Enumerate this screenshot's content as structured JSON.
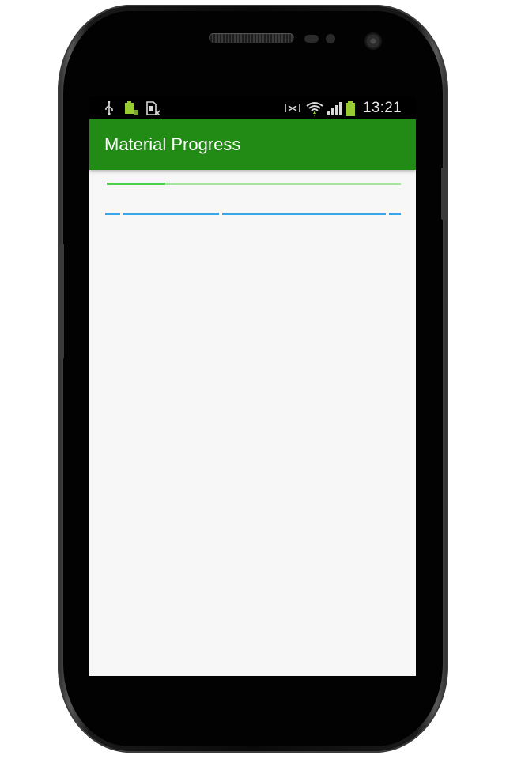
{
  "app": {
    "title": "Material Progress"
  },
  "status_bar": {
    "time": "13:21",
    "left_icons": [
      "usb-icon",
      "battery-full-icon",
      "sim-card-icon"
    ],
    "right_icons": [
      "no-signal-icon",
      "wifi-icon",
      "signal-icon",
      "battery-icon"
    ]
  },
  "progress": {
    "determinate_value": 0.2,
    "indeterminate": true
  },
  "colors": {
    "action_bar": "#218b15",
    "progress_track": "#a6e79d",
    "progress_fill": "#4cd24a",
    "indeterminate_bar": "#3aa6e8",
    "status_icons_accent": "#99cc33",
    "background": "#f7f7f7"
  }
}
